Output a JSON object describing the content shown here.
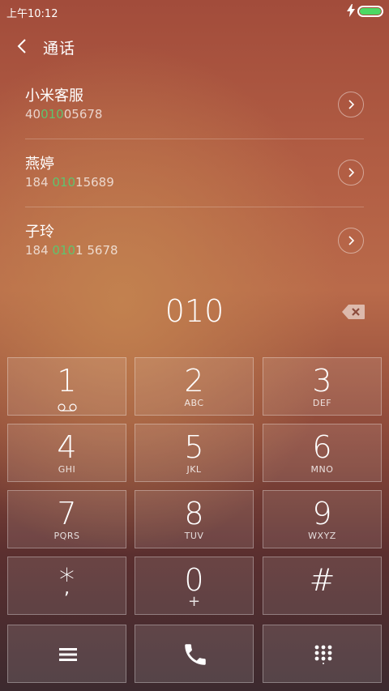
{
  "status_bar": {
    "time": "上午10:12",
    "charging_icon": "bolt-icon",
    "battery_icon": "battery-icon",
    "battery_color": "#4cd964"
  },
  "header": {
    "back_icon": "chevron-left-icon",
    "title": "通话"
  },
  "results": [
    {
      "name": "小米客服",
      "number_pre": "40",
      "number_match": "010",
      "number_post": "05678"
    },
    {
      "name": "燕婷",
      "number_pre": "184 ",
      "number_match": "010",
      "number_post": "15689"
    },
    {
      "name": "子玲",
      "number_pre": "184 ",
      "number_match": "010",
      "number_post": "1 5678"
    }
  ],
  "highlight_color": "#5ec46f",
  "entry": {
    "digits": "010",
    "backspace_icon": "backspace-icon"
  },
  "keypad": [
    {
      "digit": "1",
      "letters": ""
    },
    {
      "digit": "2",
      "letters": "ABC"
    },
    {
      "digit": "3",
      "letters": "DEF"
    },
    {
      "digit": "4",
      "letters": "GHI"
    },
    {
      "digit": "5",
      "letters": "JKL"
    },
    {
      "digit": "6",
      "letters": "MNO"
    },
    {
      "digit": "7",
      "letters": "PQRS"
    },
    {
      "digit": "8",
      "letters": "TUV"
    },
    {
      "digit": "9",
      "letters": "WXYZ"
    },
    {
      "digit": "*",
      "letters": ","
    },
    {
      "digit": "0",
      "letters": "+"
    },
    {
      "digit": "#",
      "letters": ""
    }
  ],
  "actions": {
    "menu_icon": "menu-icon",
    "call_icon": "phone-icon",
    "dialpad_icon": "dialpad-icon"
  }
}
